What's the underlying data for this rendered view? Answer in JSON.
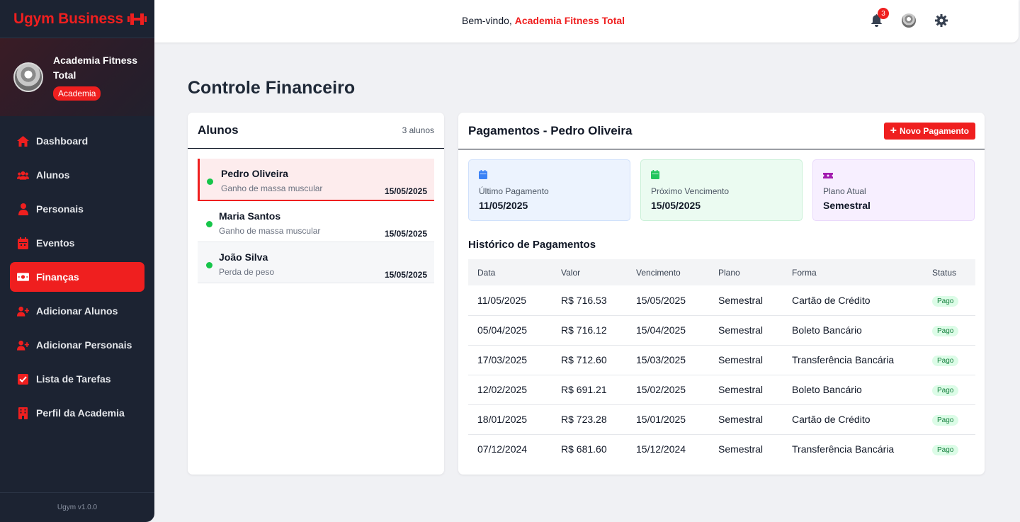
{
  "app": {
    "brand": "Ugym Business",
    "version": "Ugym v1.0.0"
  },
  "profile": {
    "name": "Academia Fitness Total",
    "badge": "Academia"
  },
  "sidebar": {
    "items": [
      {
        "label": "Dashboard",
        "icon": "home-icon"
      },
      {
        "label": "Alunos",
        "icon": "users-icon"
      },
      {
        "label": "Personais",
        "icon": "trainer-icon"
      },
      {
        "label": "Eventos",
        "icon": "calendar-icon"
      },
      {
        "label": "Finanças",
        "icon": "money-icon",
        "active": true
      },
      {
        "label": "Adicionar Alunos",
        "icon": "user-plus-icon"
      },
      {
        "label": "Adicionar Personais",
        "icon": "user-plus-icon"
      },
      {
        "label": "Lista de Tarefas",
        "icon": "checkbox-icon"
      },
      {
        "label": "Perfil da Academia",
        "icon": "building-icon"
      }
    ]
  },
  "header": {
    "welcome_prefix": "Bem-vindo,",
    "welcome_name": "Academia Fitness Total",
    "notification_count": "3"
  },
  "page": {
    "title": "Controle Financeiro"
  },
  "students": {
    "title": "Alunos",
    "count": "3 alunos",
    "items": [
      {
        "name": "Pedro Oliveira",
        "goal": "Ganho de massa muscular",
        "date": "15/05/2025"
      },
      {
        "name": "Maria Santos",
        "goal": "Ganho de massa muscular",
        "date": "15/05/2025"
      },
      {
        "name": "João Silva",
        "goal": "Perda de peso",
        "date": "15/05/2025"
      }
    ]
  },
  "payments": {
    "title": "Pagamentos - Pedro Oliveira",
    "new_button": "Novo Pagamento",
    "summary": {
      "last_label": "Último Pagamento",
      "last_value": "11/05/2025",
      "next_label": "Próximo Vencimento",
      "next_value": "15/05/2025",
      "plan_label": "Plano Atual",
      "plan_value": "Semestral"
    },
    "history_title": "Histórico de Pagamentos",
    "columns": [
      "Data",
      "Valor",
      "Vencimento",
      "Plano",
      "Forma",
      "Status"
    ],
    "rows": [
      [
        "11/05/2025",
        "R$ 716.53",
        "15/05/2025",
        "Semestral",
        "Cartão de Crédito",
        "Pago"
      ],
      [
        "05/04/2025",
        "R$ 716.12",
        "15/04/2025",
        "Semestral",
        "Boleto Bancário",
        "Pago"
      ],
      [
        "17/03/2025",
        "R$ 712.60",
        "15/03/2025",
        "Semestral",
        "Transferência Bancária",
        "Pago"
      ],
      [
        "12/02/2025",
        "R$ 691.21",
        "15/02/2025",
        "Semestral",
        "Boleto Bancário",
        "Pago"
      ],
      [
        "18/01/2025",
        "R$ 723.28",
        "15/01/2025",
        "Semestral",
        "Cartão de Crédito",
        "Pago"
      ],
      [
        "07/12/2024",
        "R$ 681.60",
        "15/12/2024",
        "Semestral",
        "Transferência Bancária",
        "Pago"
      ]
    ]
  },
  "colors": {
    "accent": "#ef1f1f",
    "sidebar_bg": "#1c2332",
    "status_paid": "#15803d"
  }
}
